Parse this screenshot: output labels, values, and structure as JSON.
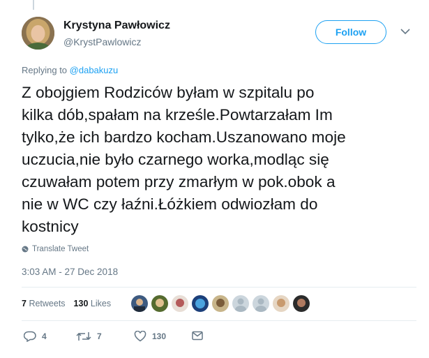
{
  "author": {
    "display_name": "Krystyna Pawłowicz",
    "handle": "@KrystPawlowicz"
  },
  "follow_label": "Follow",
  "replying": {
    "prefix": "Replying to",
    "target": "@dabakuzu"
  },
  "tweet_lines": [
    "Z obojgiem Rodziców byłam w szpitalu po",
    "kilka dób,spałam na krześle.Powtarzałam Im",
    "tylko,że ich bardzo kocham.Uszanowano moje",
    "uczucia,nie było czarnego worka,modląc się",
    "czuwałam potem przy zmarłym w pok.obok a",
    "nie w WC czy łaźni.Łóżkiem odwiozłam do",
    "kostnicy"
  ],
  "translate_label": "Translate Tweet",
  "timestamp": "3:03 AM - 27 Dec 2018",
  "stats": {
    "retweets_count": "7",
    "retweets_label": "Retweets",
    "likes_count": "130",
    "likes_label": "Likes"
  },
  "liker_avatars": 9,
  "actions": {
    "replies": "4",
    "retweets": "7",
    "likes": "130"
  },
  "colors": {
    "accent": "#1da1f2",
    "secondary_text": "#657786",
    "divider": "#e6ecf0"
  }
}
